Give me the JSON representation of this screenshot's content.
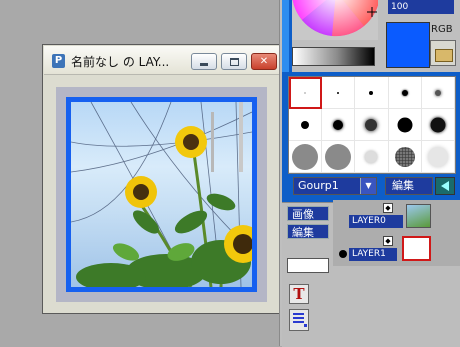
{
  "document_window": {
    "title": "名前なし の LAY...",
    "app_icon_glyph": "P"
  },
  "color_panel": {
    "hex_value": "100",
    "mode_label": "RGB",
    "current_color": "#0a5bff"
  },
  "brush_panel": {
    "group_value": "Gourp1",
    "group_arrow": "▼",
    "edit_label": "編集"
  },
  "layer_panel": {
    "image_label": "画像",
    "edit_label": "編集",
    "arrow_glyph": "◆",
    "layers": [
      {
        "name": "LAYER0"
      },
      {
        "name": "LAYER1",
        "active": true
      }
    ]
  },
  "tools": {
    "text_tool_glyph": "T"
  },
  "icons": [
    "app-icon",
    "minimize-icon",
    "maximize-icon",
    "close-icon",
    "color-wheel-icon",
    "folder-icon",
    "dropdown-arrow-icon",
    "play-icon",
    "text-tool-icon",
    "list-tool-icon"
  ]
}
